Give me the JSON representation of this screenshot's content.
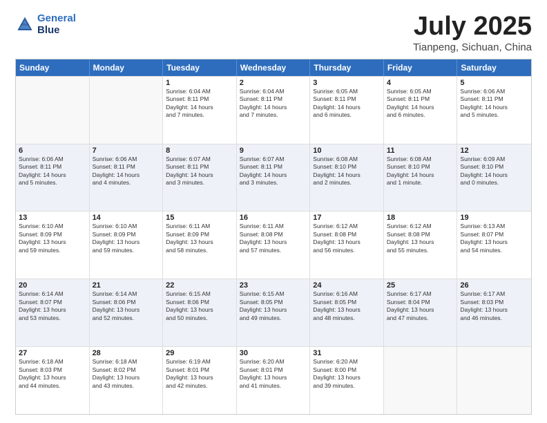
{
  "header": {
    "logo_line1": "General",
    "logo_line2": "Blue",
    "month": "July 2025",
    "location": "Tianpeng, Sichuan, China"
  },
  "weekdays": [
    "Sunday",
    "Monday",
    "Tuesday",
    "Wednesday",
    "Thursday",
    "Friday",
    "Saturday"
  ],
  "rows": [
    [
      {
        "day": "",
        "text": ""
      },
      {
        "day": "",
        "text": ""
      },
      {
        "day": "1",
        "text": "Sunrise: 6:04 AM\nSunset: 8:11 PM\nDaylight: 14 hours\nand 7 minutes."
      },
      {
        "day": "2",
        "text": "Sunrise: 6:04 AM\nSunset: 8:11 PM\nDaylight: 14 hours\nand 7 minutes."
      },
      {
        "day": "3",
        "text": "Sunrise: 6:05 AM\nSunset: 8:11 PM\nDaylight: 14 hours\nand 6 minutes."
      },
      {
        "day": "4",
        "text": "Sunrise: 6:05 AM\nSunset: 8:11 PM\nDaylight: 14 hours\nand 6 minutes."
      },
      {
        "day": "5",
        "text": "Sunrise: 6:06 AM\nSunset: 8:11 PM\nDaylight: 14 hours\nand 5 minutes."
      }
    ],
    [
      {
        "day": "6",
        "text": "Sunrise: 6:06 AM\nSunset: 8:11 PM\nDaylight: 14 hours\nand 5 minutes."
      },
      {
        "day": "7",
        "text": "Sunrise: 6:06 AM\nSunset: 8:11 PM\nDaylight: 14 hours\nand 4 minutes."
      },
      {
        "day": "8",
        "text": "Sunrise: 6:07 AM\nSunset: 8:11 PM\nDaylight: 14 hours\nand 3 minutes."
      },
      {
        "day": "9",
        "text": "Sunrise: 6:07 AM\nSunset: 8:11 PM\nDaylight: 14 hours\nand 3 minutes."
      },
      {
        "day": "10",
        "text": "Sunrise: 6:08 AM\nSunset: 8:10 PM\nDaylight: 14 hours\nand 2 minutes."
      },
      {
        "day": "11",
        "text": "Sunrise: 6:08 AM\nSunset: 8:10 PM\nDaylight: 14 hours\nand 1 minute."
      },
      {
        "day": "12",
        "text": "Sunrise: 6:09 AM\nSunset: 8:10 PM\nDaylight: 14 hours\nand 0 minutes."
      }
    ],
    [
      {
        "day": "13",
        "text": "Sunrise: 6:10 AM\nSunset: 8:09 PM\nDaylight: 13 hours\nand 59 minutes."
      },
      {
        "day": "14",
        "text": "Sunrise: 6:10 AM\nSunset: 8:09 PM\nDaylight: 13 hours\nand 59 minutes."
      },
      {
        "day": "15",
        "text": "Sunrise: 6:11 AM\nSunset: 8:09 PM\nDaylight: 13 hours\nand 58 minutes."
      },
      {
        "day": "16",
        "text": "Sunrise: 6:11 AM\nSunset: 8:08 PM\nDaylight: 13 hours\nand 57 minutes."
      },
      {
        "day": "17",
        "text": "Sunrise: 6:12 AM\nSunset: 8:08 PM\nDaylight: 13 hours\nand 56 minutes."
      },
      {
        "day": "18",
        "text": "Sunrise: 6:12 AM\nSunset: 8:08 PM\nDaylight: 13 hours\nand 55 minutes."
      },
      {
        "day": "19",
        "text": "Sunrise: 6:13 AM\nSunset: 8:07 PM\nDaylight: 13 hours\nand 54 minutes."
      }
    ],
    [
      {
        "day": "20",
        "text": "Sunrise: 6:14 AM\nSunset: 8:07 PM\nDaylight: 13 hours\nand 53 minutes."
      },
      {
        "day": "21",
        "text": "Sunrise: 6:14 AM\nSunset: 8:06 PM\nDaylight: 13 hours\nand 52 minutes."
      },
      {
        "day": "22",
        "text": "Sunrise: 6:15 AM\nSunset: 8:06 PM\nDaylight: 13 hours\nand 50 minutes."
      },
      {
        "day": "23",
        "text": "Sunrise: 6:15 AM\nSunset: 8:05 PM\nDaylight: 13 hours\nand 49 minutes."
      },
      {
        "day": "24",
        "text": "Sunrise: 6:16 AM\nSunset: 8:05 PM\nDaylight: 13 hours\nand 48 minutes."
      },
      {
        "day": "25",
        "text": "Sunrise: 6:17 AM\nSunset: 8:04 PM\nDaylight: 13 hours\nand 47 minutes."
      },
      {
        "day": "26",
        "text": "Sunrise: 6:17 AM\nSunset: 8:03 PM\nDaylight: 13 hours\nand 46 minutes."
      }
    ],
    [
      {
        "day": "27",
        "text": "Sunrise: 6:18 AM\nSunset: 8:03 PM\nDaylight: 13 hours\nand 44 minutes."
      },
      {
        "day": "28",
        "text": "Sunrise: 6:18 AM\nSunset: 8:02 PM\nDaylight: 13 hours\nand 43 minutes."
      },
      {
        "day": "29",
        "text": "Sunrise: 6:19 AM\nSunset: 8:01 PM\nDaylight: 13 hours\nand 42 minutes."
      },
      {
        "day": "30",
        "text": "Sunrise: 6:20 AM\nSunset: 8:01 PM\nDaylight: 13 hours\nand 41 minutes."
      },
      {
        "day": "31",
        "text": "Sunrise: 6:20 AM\nSunset: 8:00 PM\nDaylight: 13 hours\nand 39 minutes."
      },
      {
        "day": "",
        "text": ""
      },
      {
        "day": "",
        "text": ""
      }
    ]
  ]
}
